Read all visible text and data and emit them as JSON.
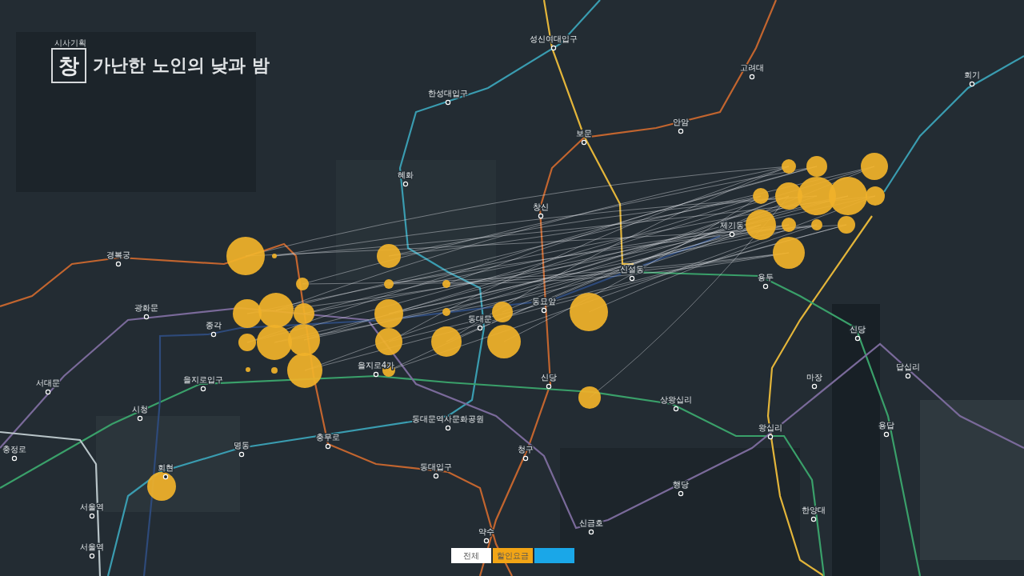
{
  "program": {
    "series": "시사기획",
    "logo": "창",
    "title": "가난한 노인의 낮과 밤"
  },
  "map": {
    "stations": [
      {
        "name": "성신여대입구"
      },
      {
        "name": "한성대입구"
      },
      {
        "name": "고려대"
      },
      {
        "name": "회기"
      },
      {
        "name": "안암"
      },
      {
        "name": "보문"
      },
      {
        "name": "혜화"
      },
      {
        "name": "창신"
      },
      {
        "name": "제기동"
      },
      {
        "name": "경복궁"
      },
      {
        "name": "신설동"
      },
      {
        "name": "광화문"
      },
      {
        "name": "종각"
      },
      {
        "name": "동대문"
      },
      {
        "name": "동묘앞"
      },
      {
        "name": "용두"
      },
      {
        "name": "을지로4가"
      },
      {
        "name": "을지로입구"
      },
      {
        "name": "동대문역사문화공원"
      },
      {
        "name": "서대문"
      },
      {
        "name": "시청"
      },
      {
        "name": "충정로"
      },
      {
        "name": "명동"
      },
      {
        "name": "충무로"
      },
      {
        "name": "회현"
      },
      {
        "name": "동대입구"
      },
      {
        "name": "서울역"
      },
      {
        "name": "서울역"
      },
      {
        "name": "약수"
      },
      {
        "name": "청구"
      },
      {
        "name": "신당"
      },
      {
        "name": "신당"
      },
      {
        "name": "상왕십리"
      },
      {
        "name": "마장"
      },
      {
        "name": "답십리"
      },
      {
        "name": "왕십리"
      },
      {
        "name": "용답"
      },
      {
        "name": "행당"
      },
      {
        "name": "신금호"
      },
      {
        "name": "한양대"
      }
    ]
  },
  "legend": [
    {
      "label": "전체",
      "color": "#ffffff"
    },
    {
      "label": "할인요금",
      "color": "#f2a516"
    },
    {
      "color": "#1aa7e8"
    }
  ]
}
